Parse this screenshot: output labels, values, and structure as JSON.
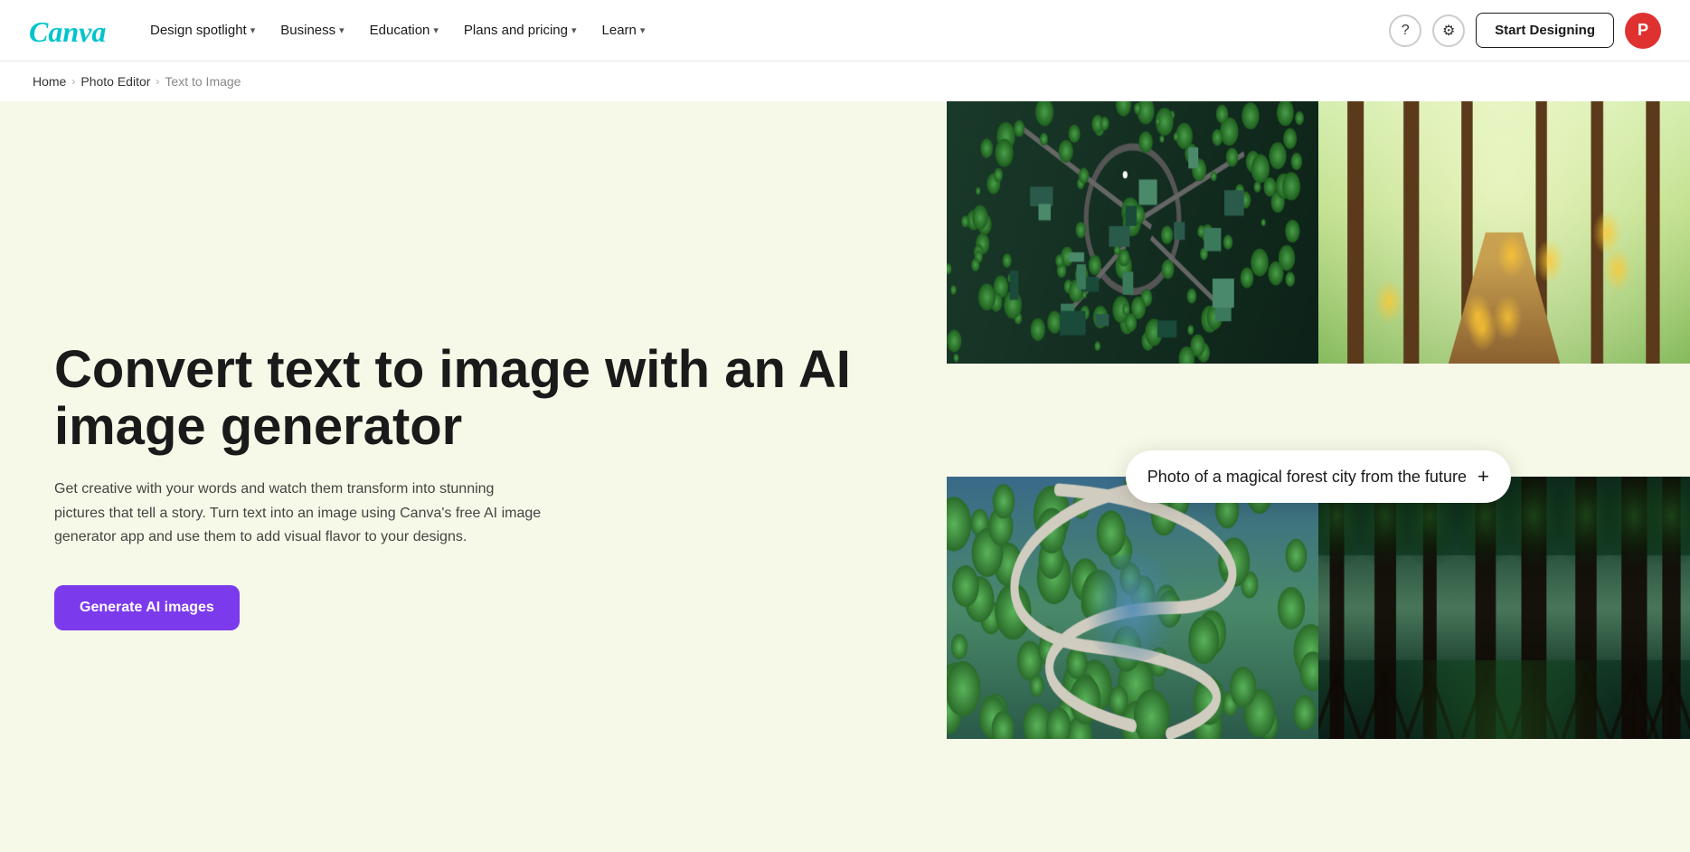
{
  "nav": {
    "logo_text": "Canva",
    "items": [
      {
        "label": "Design spotlight",
        "id": "design-spotlight"
      },
      {
        "label": "Business",
        "id": "business"
      },
      {
        "label": "Education",
        "id": "education"
      },
      {
        "label": "Plans and pricing",
        "id": "plans-pricing"
      },
      {
        "label": "Learn",
        "id": "learn"
      }
    ],
    "start_label": "Start Designing",
    "help_icon": "?",
    "settings_icon": "⚙"
  },
  "breadcrumb": {
    "home": "Home",
    "photo_editor": "Photo Editor",
    "current": "Text to Image"
  },
  "hero": {
    "title": "Convert text to image with an AI image generator",
    "description": "Get creative with your words and watch them transform into stunning pictures that tell a story. Turn text into an image using Canva's free AI image generator app and use them to add visual flavor to your designs.",
    "cta_label": "Generate AI images",
    "prompt_text": "Photo of a magical forest city from the future"
  },
  "images": {
    "top_left_desc": "Aerial view of futuristic forest city",
    "top_right_desc": "Magical glowing forest path",
    "bottom_left_desc": "Aerial winding road through trees",
    "bottom_right_desc": "Tall ancient forest trees"
  }
}
